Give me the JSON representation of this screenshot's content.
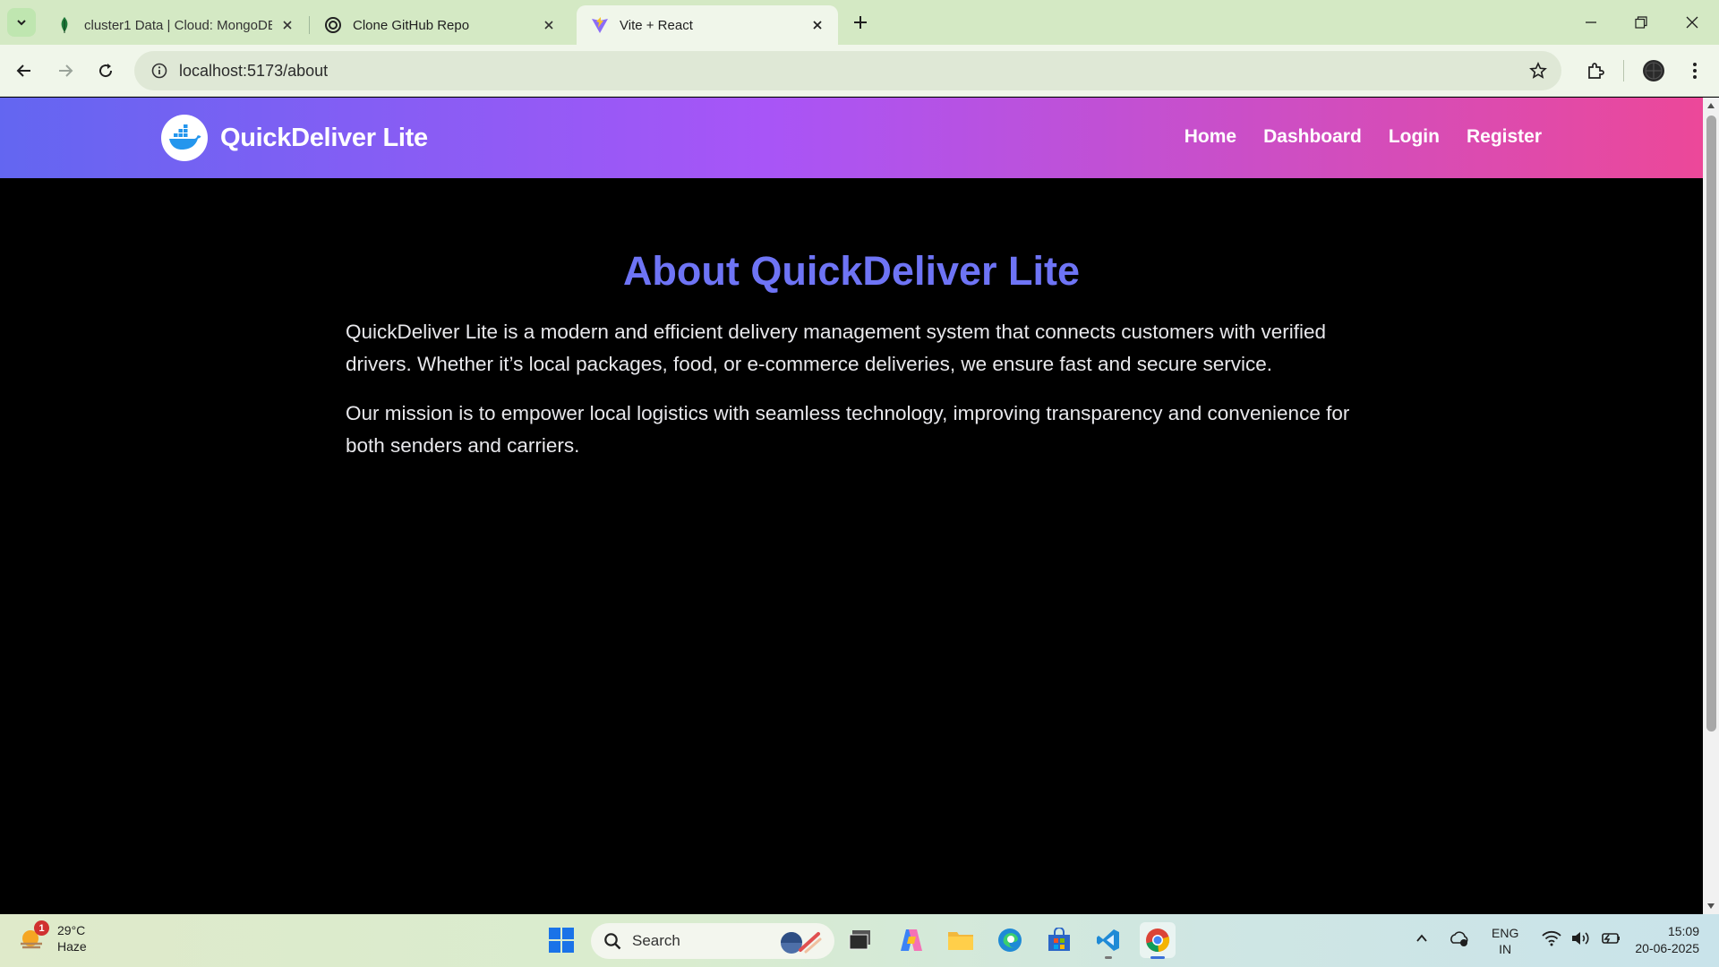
{
  "browser": {
    "tabs": [
      {
        "title": "cluster1 Data | Cloud: MongoDB",
        "favicon": "mongodb-leaf-icon",
        "active": false
      },
      {
        "title": "Clone GitHub Repo",
        "favicon": "openai-icon",
        "active": false
      },
      {
        "title": "Vite + React",
        "favicon": "vite-icon",
        "active": true
      }
    ],
    "url": "localhost:5173/about"
  },
  "site": {
    "brand": "QuickDeliver Lite",
    "nav": [
      "Home",
      "Dashboard",
      "Login",
      "Register"
    ],
    "heading": "About QuickDeliver Lite",
    "paragraphs": [
      "QuickDeliver Lite is a modern and efficient delivery management system that connects customers with verified drivers. Whether it’s local packages, food, or e-commerce deliveries, we ensure fast and secure service.",
      "Our mission is to empower local logistics with seamless technology, improving transparency and convenience for both senders and carriers."
    ],
    "colors": {
      "gradient_start": "#6366f1",
      "gradient_mid": "#a855f7",
      "gradient_end": "#ec4899",
      "heading": "#6e74f5"
    }
  },
  "taskbar": {
    "weather": {
      "temp": "29°C",
      "condition": "Haze",
      "badge": "1"
    },
    "search_label": "Search",
    "lang": [
      "ENG",
      "IN"
    ],
    "time": "15:09",
    "date": "20-06-2025"
  }
}
